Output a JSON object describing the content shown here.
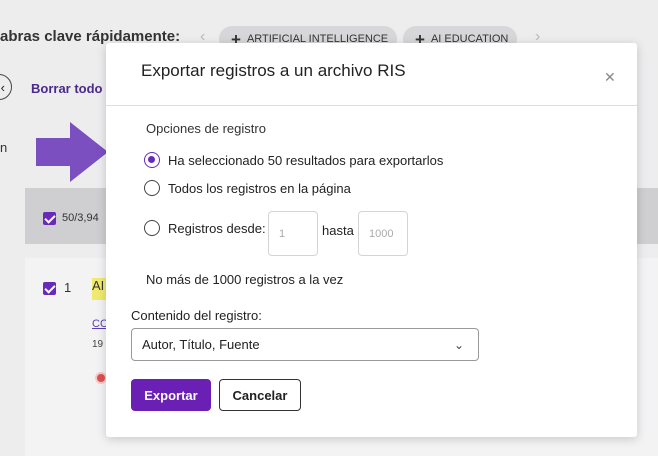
{
  "background": {
    "quick_keywords_label": "abras clave rápidamente:",
    "chips": [
      "ARTIFICIAL INTELLIGENCE",
      "AI EDUCATION"
    ],
    "clear_all": "Borrar todo",
    "truncated_n": "n",
    "selected_count": "50/3,94",
    "result_number": "1",
    "result_title_fragment": "AI",
    "result_link_fragment": "CO",
    "result_year_fragment": "19",
    "arrow_color": "#7b4fc0"
  },
  "modal": {
    "title": "Exportar registros a un archivo RIS",
    "close_icon": "close-icon",
    "section_label": "Opciones de registro",
    "options": [
      {
        "label": "Ha seleccionado 50 resultados para exportarlos",
        "selected": true
      },
      {
        "label": "Todos los registros en la página",
        "selected": false
      },
      {
        "label": "Registros desde:",
        "selected": false
      }
    ],
    "range": {
      "from_placeholder": "1",
      "to_label": "hasta",
      "to_placeholder": "1000"
    },
    "limit_note": "No más de 1000 registros a la vez",
    "content_label": "Contenido del registro:",
    "content_value": "Autor, Título, Fuente",
    "export_label": "Exportar",
    "cancel_label": "Cancelar"
  },
  "colors": {
    "accent": "#6a1fb5",
    "radio_selected": "#6a2ab9"
  }
}
